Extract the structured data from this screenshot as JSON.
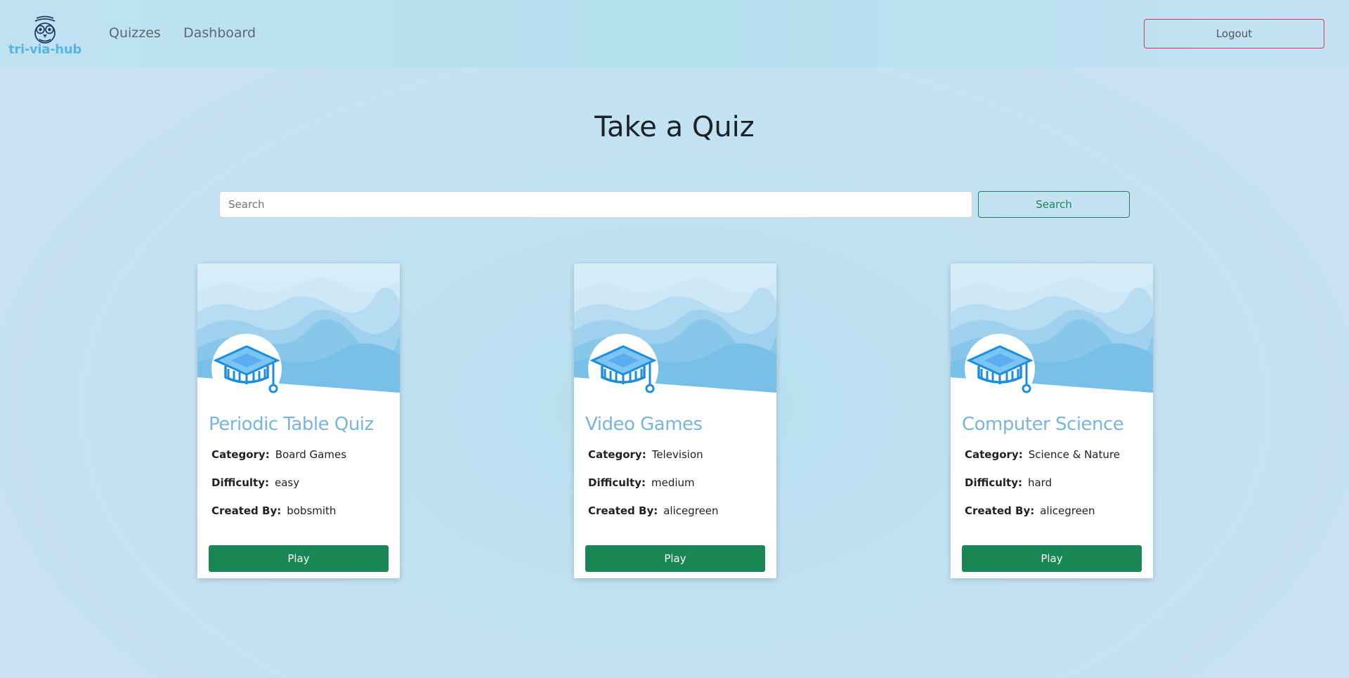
{
  "nav": {
    "brand": "tri-via-hub",
    "links": [
      {
        "label": "Quizzes"
      },
      {
        "label": "Dashboard"
      }
    ],
    "logout_label": "Logout"
  },
  "main": {
    "title": "Take a Quiz",
    "search": {
      "placeholder": "Search",
      "value": "",
      "button_label": "Search"
    },
    "labels": {
      "category": "Category:",
      "difficulty": "Difficulty:",
      "created_by": "Created By:"
    },
    "quizzes": [
      {
        "title": "Periodic Table Quiz",
        "category": "Board Games",
        "difficulty": "easy",
        "created_by": "bobsmith",
        "play_label": "Play"
      },
      {
        "title": "Video Games",
        "category": "Television",
        "difficulty": "medium",
        "created_by": "alicegreen",
        "play_label": "Play"
      },
      {
        "title": "Computer Science",
        "category": "Science & Nature",
        "difficulty": "hard",
        "created_by": "alicegreen",
        "play_label": "Play"
      }
    ]
  },
  "colors": {
    "accent_green": "#198754",
    "logout_border": "#dc3545",
    "card_title": "#79b5dc",
    "brand": "#57b5e0"
  },
  "icons": {
    "brand_logo": "owl-icon",
    "card_avatar": "graduation-cap-icon"
  }
}
